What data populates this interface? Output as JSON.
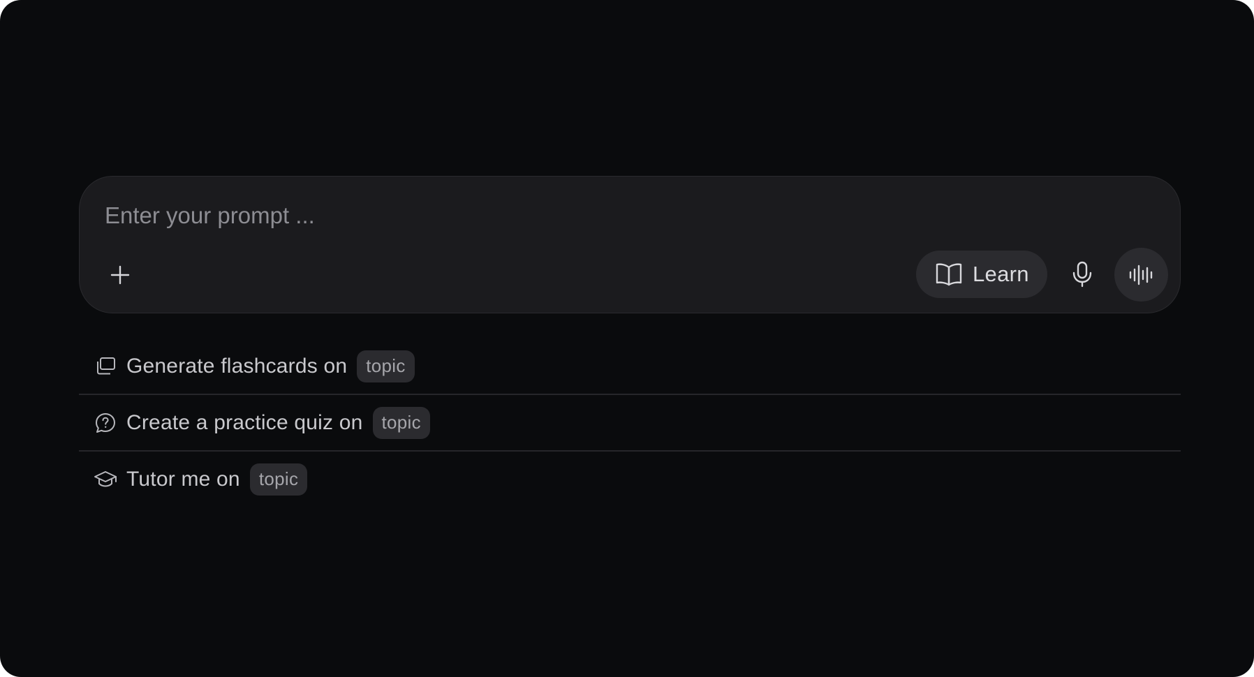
{
  "composer": {
    "placeholder": "Enter your prompt ...",
    "value": "",
    "add_icon": "plus-icon",
    "learn_label": "Learn",
    "learn_icon": "book-icon",
    "mic_icon": "microphone-icon",
    "voice_icon": "waveform-icon"
  },
  "suggestions": [
    {
      "icon": "flashcards-icon",
      "text": "Generate flashcards on",
      "tag": "topic"
    },
    {
      "icon": "question-bubble-icon",
      "text": "Create a practice quiz on",
      "tag": "topic"
    },
    {
      "icon": "graduation-cap-icon",
      "text": "Tutor me on",
      "tag": "topic"
    }
  ],
  "colors": {
    "background": "#0a0b0d",
    "composer": "#1b1b1e",
    "chip": "#2b2b2f",
    "text": "#c9c9cd",
    "placeholder": "#8d8d93"
  }
}
